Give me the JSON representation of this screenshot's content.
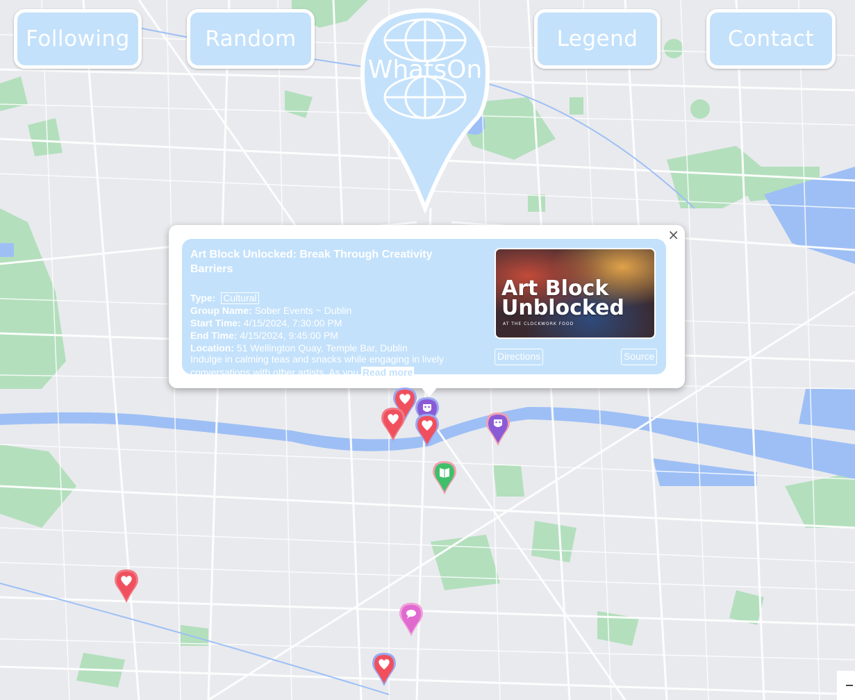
{
  "nav": {
    "following": "Following",
    "random": "Random",
    "legend": "Legend",
    "contact": "Contact"
  },
  "logo": {
    "text": "WhatsOn"
  },
  "popup": {
    "close": "×",
    "title": "Art Block Unlocked: Break Through Creativity Barriers",
    "type_label": "Type:",
    "type_value": "Cultural",
    "group_label": "Group Name:",
    "group_value": "Sober Events ~ Dublin",
    "start_label": "Start Time:",
    "start_value": "4/15/2024, 7:30:00 PM",
    "end_label": "End Time:",
    "end_value": "4/15/2024, 9:45:00 PM",
    "location_label": "Location:",
    "location_value": "51 Wellington Quay, Temple Bar, Dublin",
    "description": "Indulge in calming teas and snacks while engaging in lively conversations with other artists. As you",
    "read_more": "Read more",
    "image_title_1": "Art Block",
    "image_title_2": "Unblocked",
    "image_sub": "AT THE CLOCKWORK FOOD",
    "directions": "Directions",
    "source": "Source"
  },
  "markers": [
    {
      "icon": "heart-icon",
      "ring": "#9aa8f0"
    },
    {
      "icon": "heart-icon",
      "ring": "#f07a86"
    },
    {
      "icon": "theater-icon",
      "ring": "#9aa8f0"
    },
    {
      "icon": "heart-icon",
      "ring": "#9aa8f0"
    },
    {
      "icon": "theater-icon",
      "ring": "#f0a0b0"
    },
    {
      "icon": "book-icon",
      "ring": "#f0a0b0"
    },
    {
      "icon": "heart-icon",
      "ring": "#f07a86"
    },
    {
      "icon": "speech-bubble-icon",
      "ring": "#f0a0d8"
    },
    {
      "icon": "heart-icon",
      "ring": "#9aa8f0"
    }
  ],
  "colors": {
    "accent": "#c3e1fb",
    "water": "#9dbff5",
    "park": "#b3dfbd",
    "road": "#ffffff",
    "land": "#e9eaee"
  }
}
